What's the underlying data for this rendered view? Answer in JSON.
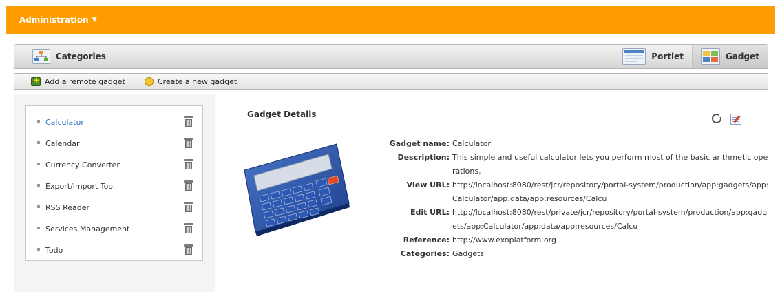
{
  "topbar": {
    "menu_label": "Administration"
  },
  "header": {
    "categories_label": "Categories",
    "portlet_label": "Portlet",
    "gadget_label": "Gadget"
  },
  "actions": {
    "add_remote": "Add a remote gadget",
    "create_new": "Create a new gadget"
  },
  "gadgets": [
    {
      "name": "Calculator",
      "selected": true
    },
    {
      "name": "Calendar"
    },
    {
      "name": "Currency Converter"
    },
    {
      "name": "Export/Import Tool"
    },
    {
      "name": "RSS Reader"
    },
    {
      "name": "Services Management"
    },
    {
      "name": "Todo"
    }
  ],
  "details": {
    "title": "Gadget Details",
    "labels": {
      "name": "Gadget name:",
      "description": "Description:",
      "view_url": "View URL:",
      "edit_url": "Edit URL:",
      "reference": "Reference:",
      "categories": "Categories:"
    },
    "values": {
      "name": "Calculator",
      "description": "This simple and useful calculator lets you perform most of the basic arithmetic operations.",
      "view_url": "http://localhost:8080/rest/jcr/repository/portal-system/production/app:gadgets/app:Calculator/app:data/app:resources/Calcu",
      "edit_url": "http://localhost:8080/rest/private/jcr/repository/portal-system/production/app:gadgets/app:Calculator/app:data/app:resources/Calcu",
      "reference": "http://www.exoplatform.org",
      "categories": "Gadgets"
    }
  },
  "colors": {
    "accent": "#ff9c00",
    "link": "#2b73c4"
  },
  "icons": [
    "chevron-down-icon",
    "categories-icon",
    "portlet-icon",
    "gadget-icon",
    "add-gadget-icon",
    "create-gadget-icon",
    "trash-icon",
    "refresh-icon",
    "edit-icon",
    "calculator-image"
  ]
}
